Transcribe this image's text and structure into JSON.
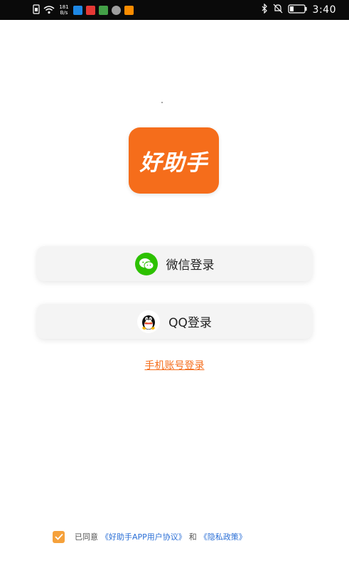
{
  "status_bar": {
    "netspeed_value": "181",
    "netspeed_unit": "B/s",
    "time": "3:40"
  },
  "logo": {
    "text": "好助手",
    "color": "#f56d1b"
  },
  "login": {
    "wechat_label": "微信登录",
    "qq_label": "QQ登录",
    "phone_label": "手机账号登录"
  },
  "agreement": {
    "prefix": "已同意",
    "user_agreement": "《好助手APP用户协议》",
    "conjunction": "和",
    "privacy_policy": "《隐私政策》",
    "checked": true
  },
  "icons": {
    "wechat": "wechat-icon",
    "qq": "qq-icon",
    "check": "check-icon"
  }
}
